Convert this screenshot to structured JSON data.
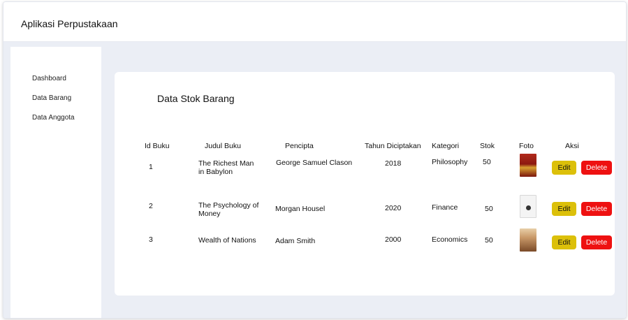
{
  "app": {
    "title": "Aplikasi Perpustakaan"
  },
  "sidebar": {
    "items": [
      {
        "label": "Dashboard"
      },
      {
        "label": "Data Barang"
      },
      {
        "label": "Data Anggota"
      }
    ]
  },
  "main": {
    "title": "Data Stok Barang",
    "table": {
      "headers": {
        "id": "Id Buku",
        "judul": "Judul Buku",
        "pencipta": "Pencipta",
        "tahun": "Tahun Diciptakan",
        "kategori": "Kategori",
        "stok": "Stok",
        "foto": "Foto",
        "aksi": "Aksi"
      },
      "rows": [
        {
          "id": "1",
          "judul": "The Richest Man in Babylon",
          "pencipta": "George Samuel Clason",
          "tahun": "2018",
          "kategori": "Philosophy",
          "stok": "50",
          "foto_icon": "book-cover-red-icon",
          "edit_label": "Edit",
          "delete_label": "Delete"
        },
        {
          "id": "2",
          "judul": "The Psychology of Money",
          "pencipta": "Morgan Housel",
          "tahun": "2020",
          "kategori": "Finance",
          "stok": "50",
          "foto_icon": "book-cover-white-icon",
          "edit_label": "Edit",
          "delete_label": "Delete"
        },
        {
          "id": "3",
          "judul": "Wealth of Nations",
          "pencipta": "Adam Smith",
          "tahun": "2000",
          "kategori": "Economics",
          "stok": "50",
          "foto_icon": "book-cover-brown-icon",
          "edit_label": "Edit",
          "delete_label": "Delete"
        }
      ]
    }
  },
  "colors": {
    "page_bg": "#ebeef5",
    "edit_button": "#dcc00a",
    "delete_button": "#ee1111"
  }
}
